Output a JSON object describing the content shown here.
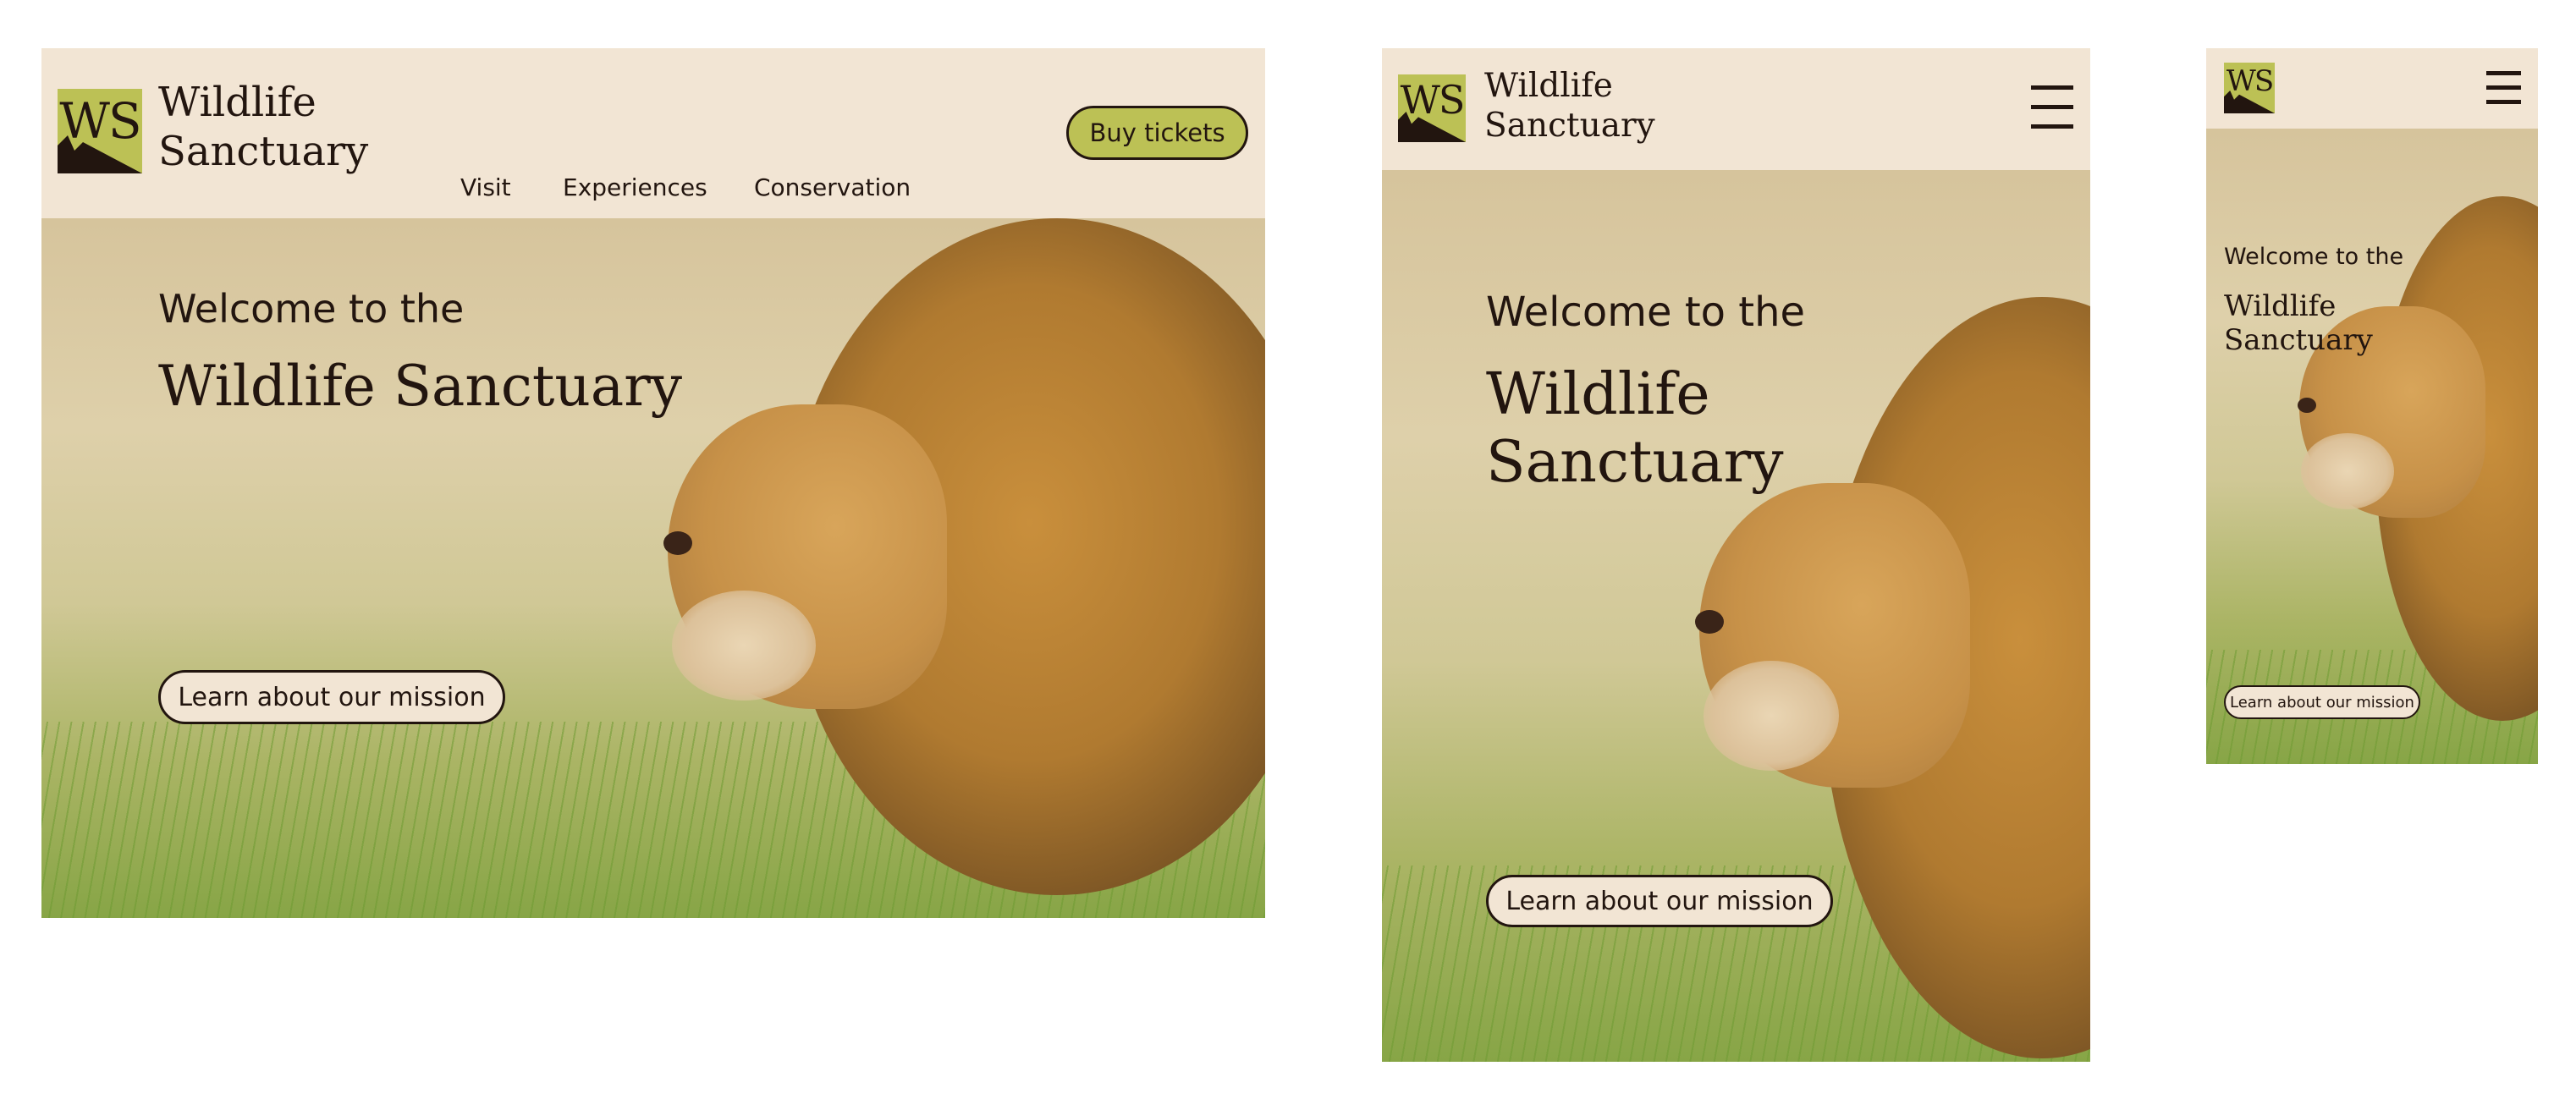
{
  "brand": {
    "logo_letters": "WS",
    "name_line1": "Wildlife",
    "name_line2": "Sanctuary"
  },
  "colors": {
    "header_bg": "#f2e5d4",
    "accent": "#bcc155",
    "text": "#22150f"
  },
  "nav": {
    "items": [
      "Visit",
      "Experiences",
      "Conservation"
    ],
    "cta": "Buy tickets",
    "menu_icon": "hamburger-icon"
  },
  "hero": {
    "kicker": "Welcome to the",
    "title": "Wildlife Sanctuary",
    "title_line1": "Wildlife",
    "title_line2": "Sanctuary",
    "cta": "Learn about our mission"
  }
}
